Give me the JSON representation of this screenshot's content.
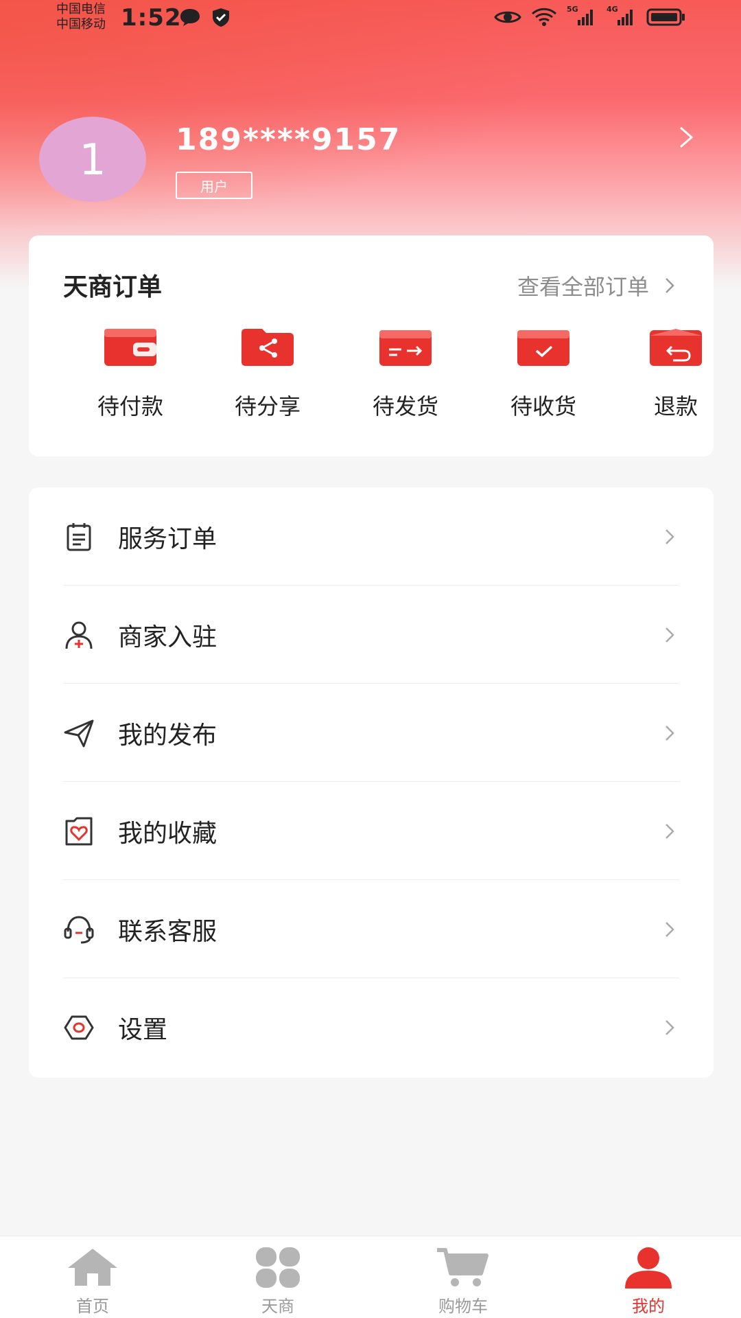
{
  "status_bar": {
    "carrier_1": "中国电信",
    "carrier_2": "中国移动",
    "time": "1:52",
    "network_1": "5G",
    "network_2": "4G"
  },
  "profile": {
    "avatar_text": "1",
    "phone": "189****9157",
    "role": "用户"
  },
  "orders": {
    "title": "天商订单",
    "view_all": "查看全部订单",
    "items": [
      {
        "label": "待付款",
        "icon": "wallet-icon"
      },
      {
        "label": "待分享",
        "icon": "share-icon"
      },
      {
        "label": "待发货",
        "icon": "shipping-icon"
      },
      {
        "label": "待收货",
        "icon": "receive-icon"
      },
      {
        "label": "退款",
        "icon": "refund-icon"
      }
    ]
  },
  "menu": {
    "items": [
      {
        "label": "服务订单",
        "icon": "clipboard-icon"
      },
      {
        "label": "商家入驻",
        "icon": "user-add-icon"
      },
      {
        "label": "我的发布",
        "icon": "send-icon"
      },
      {
        "label": "我的收藏",
        "icon": "favorite-icon"
      },
      {
        "label": "联系客服",
        "icon": "headset-icon"
      },
      {
        "label": "设置",
        "icon": "settings-icon"
      }
    ]
  },
  "tabbar": {
    "items": [
      {
        "label": "首页",
        "icon": "home-icon"
      },
      {
        "label": "天商",
        "icon": "clover-icon"
      },
      {
        "label": "购物车",
        "icon": "cart-icon"
      },
      {
        "label": "我的",
        "icon": "person-icon"
      }
    ],
    "active_index": 3
  },
  "colors": {
    "accent": "#e8322e",
    "header_gradient_start": "#f75a57",
    "avatar_bg": "#e2a5d4"
  }
}
